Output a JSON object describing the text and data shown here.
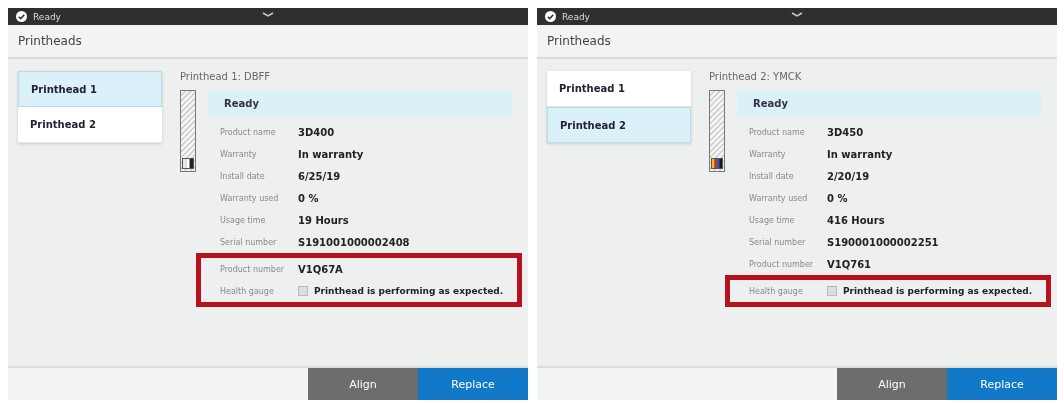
{
  "panels": [
    {
      "status": "Ready",
      "title": "Printheads",
      "tabs": [
        {
          "label": "Printhead 1",
          "selected": true
        },
        {
          "label": "Printhead 2",
          "selected": false
        }
      ],
      "heading": "Printhead 1: DBFF",
      "banner": "Ready",
      "ink_colors": [
        {
          "color": "#e8e8e8"
        },
        {
          "color": "#ffffff"
        },
        {
          "color": "#222222"
        }
      ],
      "fields": [
        {
          "kind": "text",
          "label": "Product name",
          "value": "3D400",
          "highlighted": false
        },
        {
          "kind": "text",
          "label": "Warranty",
          "value": "In warranty",
          "highlighted": false
        },
        {
          "kind": "text",
          "label": "Install date",
          "value": "6/25/19",
          "highlighted": false
        },
        {
          "kind": "text",
          "label": "Warranty used",
          "value": "0 %",
          "highlighted": false
        },
        {
          "kind": "text",
          "label": "Usage time",
          "value": "19 Hours",
          "highlighted": false
        },
        {
          "kind": "text",
          "label": "Serial number",
          "value": "S191001000002408",
          "highlighted": false
        },
        {
          "kind": "text",
          "label": "Product number",
          "value": "V1Q67A",
          "highlighted": true
        },
        {
          "kind": "checkbox",
          "label": "Health gauge",
          "value": "Printhead is performing as expected.",
          "checked": false,
          "highlighted": true
        }
      ],
      "buttons": [
        "Align",
        "Replace"
      ]
    },
    {
      "status": "Ready",
      "title": "Printheads",
      "tabs": [
        {
          "label": "Printhead 1",
          "selected": false
        },
        {
          "label": "Printhead 2",
          "selected": true
        }
      ],
      "heading": "Printhead 2: YMCK",
      "banner": "Ready",
      "ink_colors": [
        {
          "color": "#f2c200"
        },
        {
          "color": "#d42a2a"
        },
        {
          "color": "#1f5fb8"
        },
        {
          "color": "#1a1a1a"
        }
      ],
      "fields": [
        {
          "kind": "text",
          "label": "Product name",
          "value": "3D450",
          "highlighted": false
        },
        {
          "kind": "text",
          "label": "Warranty",
          "value": "In warranty",
          "highlighted": false
        },
        {
          "kind": "text",
          "label": "Install date",
          "value": "2/20/19",
          "highlighted": false
        },
        {
          "kind": "text",
          "label": "Warranty used",
          "value": "0 %",
          "highlighted": false
        },
        {
          "kind": "text",
          "label": "Usage time",
          "value": "416 Hours",
          "highlighted": false
        },
        {
          "kind": "text",
          "label": "Serial number",
          "value": "S190001000002251",
          "highlighted": false
        },
        {
          "kind": "text",
          "label": "Product number",
          "value": "V1Q761",
          "highlighted": false
        },
        {
          "kind": "checkbox",
          "label": "Health gauge",
          "value": "Printhead is performing as expected.",
          "checked": false,
          "highlighted": true
        }
      ],
      "buttons": [
        "Align",
        "Replace"
      ]
    }
  ]
}
